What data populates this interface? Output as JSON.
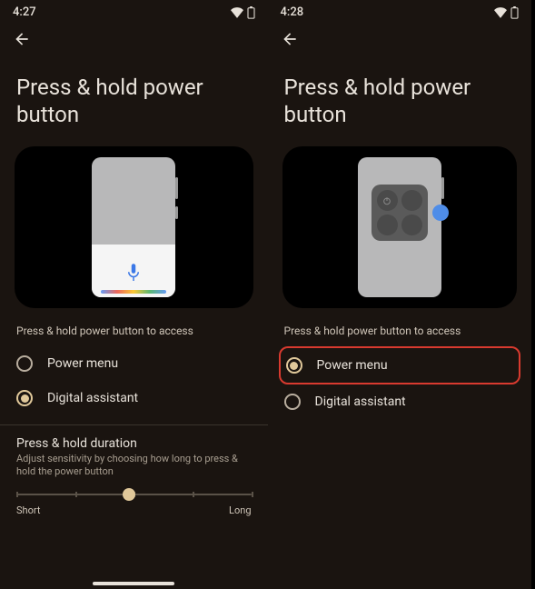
{
  "left": {
    "status": {
      "time": "4:27"
    },
    "title": "Press & hold power button",
    "section_label": "Press & hold power button to access",
    "options": [
      {
        "label": "Power menu",
        "selected": false
      },
      {
        "label": "Digital assistant",
        "selected": true
      }
    ],
    "duration": {
      "title": "Press & hold duration",
      "subtitle": "Adjust sensitivity by choosing how long to press & hold the power button",
      "min_label": "Short",
      "max_label": "Long",
      "value_pct": 48
    }
  },
  "right": {
    "status": {
      "time": "4:28"
    },
    "title": "Press & hold power button",
    "section_label": "Press & hold power button to access",
    "options": [
      {
        "label": "Power menu",
        "selected": true,
        "highlighted": true
      },
      {
        "label": "Digital assistant",
        "selected": false
      }
    ]
  }
}
